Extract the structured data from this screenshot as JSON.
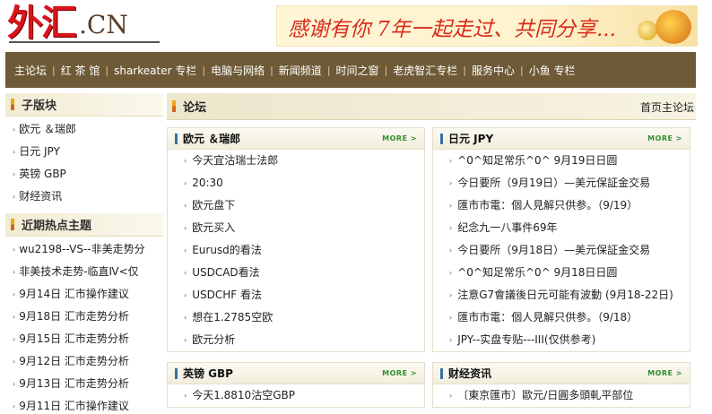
{
  "header": {
    "logo_main": "外汇",
    "logo_sub": ".CN",
    "banner_text": "感谢有你 7年一起走过、共同分享..."
  },
  "nav": {
    "items": [
      "主论坛",
      "红 茶 馆",
      "sharkeater 专栏",
      "电脑与网络",
      "新闻频道",
      "时间之窗",
      "老虎智汇专栏",
      "服务中心",
      "小鱼 专栏"
    ]
  },
  "sidebar": {
    "sub_title": "子版块",
    "sub_items": [
      "欧元 ＆瑞郎",
      "日元 JPY",
      "英镑 GBP",
      "财经资讯"
    ],
    "hot_title": "近期热点主题",
    "hot_items": [
      "wu2198--VS--非美走势分",
      "非美技术走势-临直Ⅳ<仅",
      "9月14日 汇市操作建议",
      "9月18日 汇市走势分析",
      "9月15日 汇市走势分析",
      "9月12日 汇市走势分析",
      "9月13日 汇市走势分析",
      "9月11日 汇市操作建议"
    ]
  },
  "main": {
    "title": "论坛",
    "breadcrumb": "首页主论坛",
    "more_label": "MORE >",
    "boxes": [
      {
        "title": "欧元 ＆瑞郎",
        "items": [
          "今天宜沽瑞士法郎",
          "20:30",
          "欧元盘下",
          "欧元买入",
          "Eurusd的看法",
          "USDCAD看法",
          "USDCHF 看法",
          "想在1.2785空欧",
          "欧元分析"
        ]
      },
      {
        "title": "日元 JPY",
        "items": [
          "^0^知足常乐^0^ 9月19日日圆",
          "今日要所（9月19日）—美元保証金交易",
          "匯市市電：個人見解只供参。（9/19）",
          "纪念九一八事件69年",
          "今日要所（9月18日）—美元保証金交易",
          "^0^知足常乐^0^ 9月18日日圆",
          "注意G7會議後日元可能有波動 (9月18-22日)",
          "匯市市電：個人見解只供参。（9/18）",
          "JPY--实盘专贴---III(仅供参考)"
        ]
      },
      {
        "title": "英镑 GBP",
        "items": [
          "今天1.8810沽空GBP"
        ]
      },
      {
        "title": "财经资讯",
        "items": [
          "〔東京匯市〕歐元/日圓多頭軋平部位"
        ]
      }
    ]
  }
}
